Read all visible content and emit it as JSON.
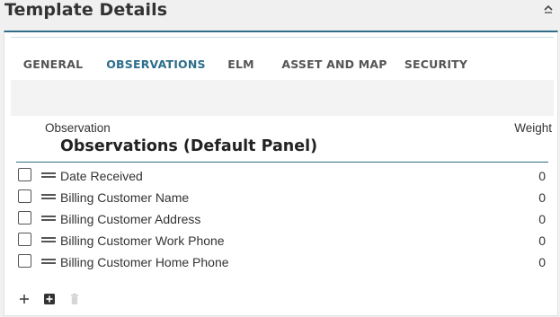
{
  "header": {
    "title": "Template Details",
    "collapse_icon": "chevron-up-icon"
  },
  "tabs": [
    {
      "label": "GENERAL",
      "active": false
    },
    {
      "label": "OBSERVATIONS",
      "active": true
    },
    {
      "label": "ELM",
      "active": false
    },
    {
      "label": "ASSET AND MAP",
      "active": false
    },
    {
      "label": "SECURITY",
      "active": false
    }
  ],
  "table": {
    "col_observation": "Observation",
    "col_weight": "Weight",
    "section_title": "Observations (Default Panel)",
    "rows": [
      {
        "label": "Date Received",
        "weight": "0"
      },
      {
        "label": "Billing Customer Name",
        "weight": "0"
      },
      {
        "label": "Billing Customer Address",
        "weight": "0"
      },
      {
        "label": "Billing Customer Work Phone",
        "weight": "0"
      },
      {
        "label": "Billing Customer Home Phone",
        "weight": "0"
      }
    ]
  },
  "toolbar": {
    "add_icon": "plus-icon",
    "add_panel_icon": "plus-square-icon",
    "delete_icon": "trash-icon"
  },
  "colors": {
    "accent": "#2c6e8b",
    "tab_underline": "#f0a93a"
  }
}
